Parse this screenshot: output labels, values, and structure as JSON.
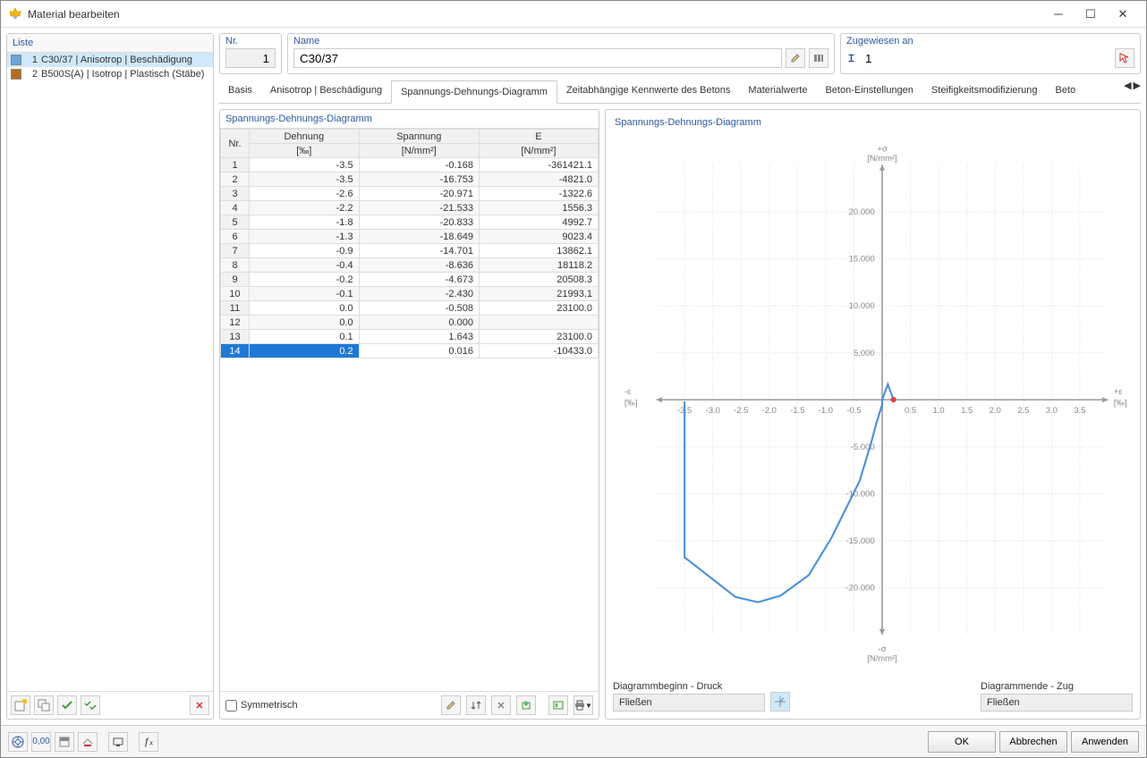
{
  "window": {
    "title": "Material bearbeiten"
  },
  "list": {
    "header": "Liste",
    "items": [
      {
        "idx": "1",
        "label": "C30/37 | Anisotrop | Beschädigung",
        "color": "#6ba5d8",
        "selected": true
      },
      {
        "idx": "2",
        "label": "B500S(A) | Isotrop | Plastisch (Stäbe)",
        "color": "#b86b1e",
        "selected": false
      }
    ]
  },
  "fields": {
    "nr_label": "Nr.",
    "nr_value": "1",
    "name_label": "Name",
    "name_value": "C30/37",
    "zu_label": "Zugewiesen an",
    "zu_value": "1"
  },
  "tabs": {
    "items": [
      "Basis",
      "Anisotrop | Beschädigung",
      "Spannungs-Dehnungs-Diagramm",
      "Zeitabhängige Kennwerte des Betons",
      "Materialwerte",
      "Beton-Einstellungen",
      "Steifigkeitsmodifizierung",
      "Beto"
    ],
    "selectedIndex": 2
  },
  "table": {
    "title": "Spannungs-Dehnungs-Diagramm",
    "headers": {
      "nr": "Nr.",
      "dehnung": "Dehnung",
      "dehnung_unit": "[‰]",
      "spannung": "Spannung",
      "spannung_unit": "[N/mm²]",
      "e": "E",
      "e_unit": "[N/mm²]"
    },
    "rows": [
      {
        "nr": "1",
        "d": "-3.5",
        "s": "-0.168",
        "e": "-361421.1"
      },
      {
        "nr": "2",
        "d": "-3.5",
        "s": "-16.753",
        "e": "-4821.0"
      },
      {
        "nr": "3",
        "d": "-2.6",
        "s": "-20.971",
        "e": "-1322.6"
      },
      {
        "nr": "4",
        "d": "-2.2",
        "s": "-21.533",
        "e": "1556.3"
      },
      {
        "nr": "5",
        "d": "-1.8",
        "s": "-20.833",
        "e": "4992.7"
      },
      {
        "nr": "6",
        "d": "-1.3",
        "s": "-18.649",
        "e": "9023.4"
      },
      {
        "nr": "7",
        "d": "-0.9",
        "s": "-14.701",
        "e": "13862.1"
      },
      {
        "nr": "8",
        "d": "-0.4",
        "s": "-8.636",
        "e": "18118.2"
      },
      {
        "nr": "9",
        "d": "-0.2",
        "s": "-4.673",
        "e": "20508.3"
      },
      {
        "nr": "10",
        "d": "-0.1",
        "s": "-2.430",
        "e": "21993.1"
      },
      {
        "nr": "11",
        "d": "0.0",
        "s": "-0.508",
        "e": "23100.0"
      },
      {
        "nr": "12",
        "d": "0.0",
        "s": "0.000",
        "e": ""
      },
      {
        "nr": "13",
        "d": "0.1",
        "s": "1.643",
        "e": "23100.0"
      },
      {
        "nr": "14",
        "d": "0.2",
        "s": "0.016",
        "e": "-10433.0"
      }
    ],
    "selectedRow": 13,
    "symmetrisch_label": "Symmetrisch"
  },
  "chart": {
    "title": "Spannungs-Dehnungs-Diagramm",
    "ylabel_top": "+σ",
    "yunit": "[N/mm²]",
    "ylabel_bottom": "-σ",
    "xlabel_left": "-ε",
    "xlabel_right": "+ε",
    "xunit": "[‰]",
    "diag_begin_label": "Diagrammbeginn - Druck",
    "diag_begin_value": "Fließen",
    "diag_end_label": "Diagrammende - Zug",
    "diag_end_value": "Fließen"
  },
  "chart_data": {
    "type": "line",
    "x": [
      -3.5,
      -3.5,
      -2.6,
      -2.2,
      -1.8,
      -1.3,
      -0.9,
      -0.4,
      -0.2,
      -0.1,
      0.0,
      0.0,
      0.1,
      0.2
    ],
    "y": [
      -0.168,
      -16.753,
      -20.971,
      -21.533,
      -20.833,
      -18.649,
      -14.701,
      -8.636,
      -4.673,
      -2.43,
      -0.508,
      0.0,
      1.643,
      0.016
    ],
    "xlim": [
      -4.0,
      4.0
    ],
    "ylim": [
      -25,
      25
    ],
    "xticks": [
      -3.5,
      -3.0,
      -2.5,
      -2.0,
      -1.5,
      -1.0,
      -0.5,
      0.5,
      1.0,
      1.5,
      2.0,
      2.5,
      3.0,
      3.5
    ],
    "yticks": [
      20000,
      15000,
      10000,
      5000,
      -5000,
      -10000,
      -15000,
      -20000
    ],
    "ytick_values": [
      20,
      15,
      10,
      5,
      -5,
      -10,
      -15,
      -20
    ]
  },
  "buttons": {
    "ok": "OK",
    "cancel": "Abbrechen",
    "apply": "Anwenden"
  }
}
